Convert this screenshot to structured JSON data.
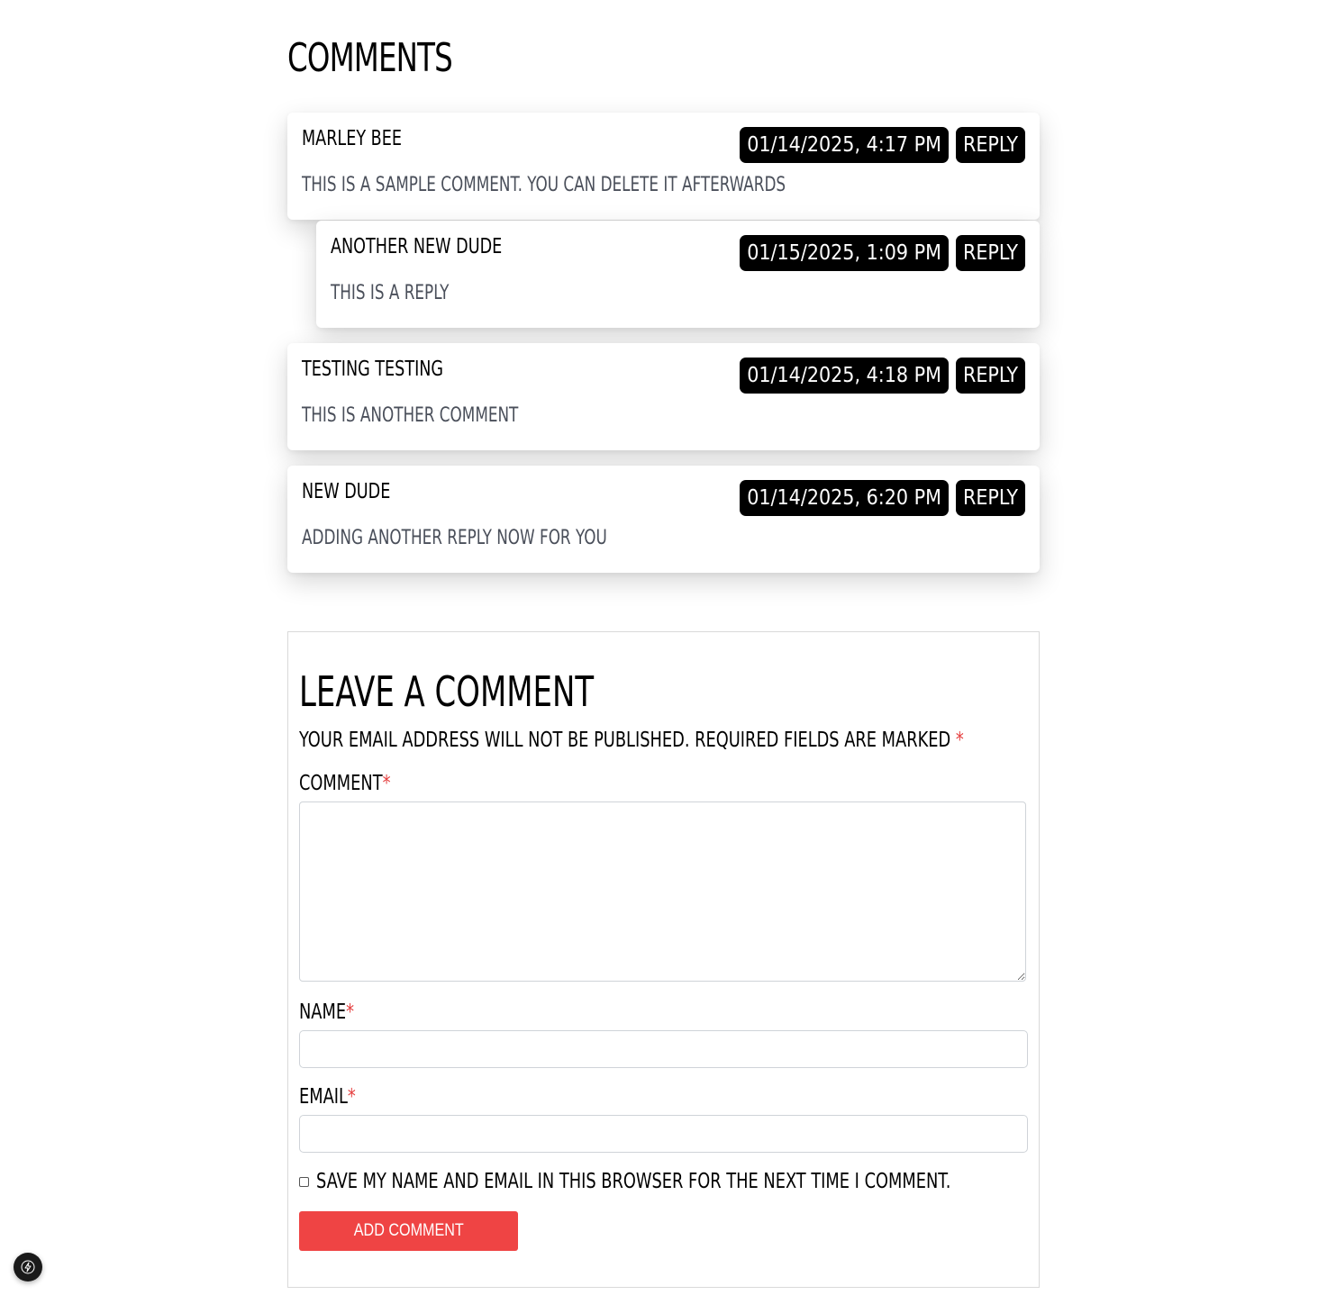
{
  "comments_section": {
    "title": "Comments"
  },
  "comments": [
    {
      "author": "Marley Bee",
      "timestamp": "01/14/2025, 4:17 PM",
      "body": "This is a sample comment. You can delete it afterwards",
      "reply_label": "Reply",
      "is_reply": false
    },
    {
      "author": "Another New Dude",
      "timestamp": "01/15/2025, 1:09 PM",
      "body": "This is a reply",
      "reply_label": "Reply",
      "is_reply": true
    },
    {
      "author": "Testing Testing",
      "timestamp": "01/14/2025, 4:18 PM",
      "body": "This is another comment",
      "reply_label": "Reply",
      "is_reply": false
    },
    {
      "author": "New Dude",
      "timestamp": "01/14/2025, 6:20 PM",
      "body": "Adding another reply now for you",
      "reply_label": "Reply",
      "is_reply": false
    }
  ],
  "form": {
    "title": "Leave a Comment",
    "note": "Your email address will not be published. Required fields are marked",
    "required_marker": "*",
    "comment_label": "Comment",
    "comment_value": "",
    "name_label": "Name",
    "name_value": "",
    "email_label": "Email",
    "email_value": "",
    "save_label": "Save my name and email in this browser for the next time I comment.",
    "save_checked": false,
    "submit_label": "Add Comment"
  },
  "colors": {
    "accent": "#ef4444",
    "required": "#e53e3e",
    "pill_bg": "#000000",
    "body_text": "#4a4f5a"
  },
  "icons": {
    "dev_badge": "lightning-bolt-icon"
  }
}
